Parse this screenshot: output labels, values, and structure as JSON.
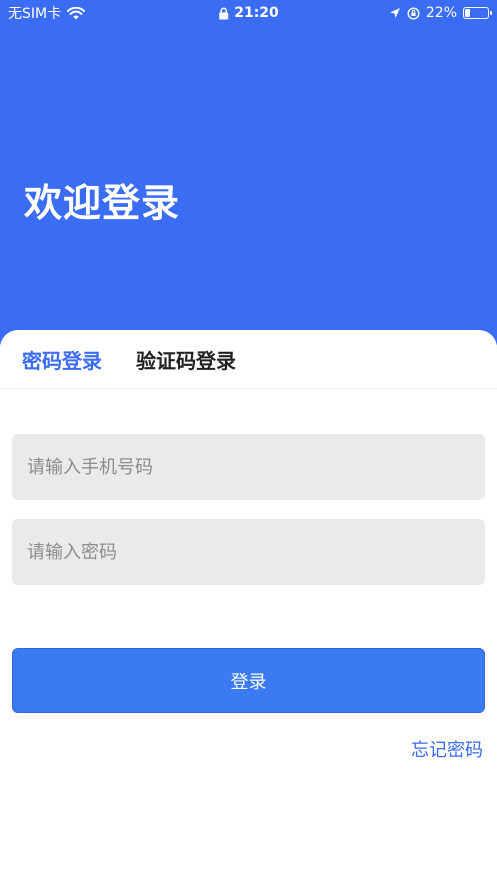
{
  "status_bar": {
    "carrier": "无SIM卡",
    "time": "21:20",
    "battery_percent": "22%",
    "battery_level": 0.22,
    "icons": [
      "wifi-icon",
      "lock-icon",
      "location-icon",
      "orientation-lock-icon",
      "battery-icon"
    ]
  },
  "header": {
    "title": "欢迎登录",
    "background_color": "#3a6cf4"
  },
  "tabs": [
    {
      "label": "密码登录",
      "active": true
    },
    {
      "label": "验证码登录",
      "active": false
    }
  ],
  "form": {
    "phone_placeholder": "请输入手机号码",
    "phone_value": "",
    "password_placeholder": "请输入密码",
    "password_value": "",
    "login_label": "登录",
    "forgot_label": "忘记密码"
  },
  "colors": {
    "accent": "#3a6cf4",
    "button": "#3a7af2",
    "field_bg": "#eaeaea"
  }
}
